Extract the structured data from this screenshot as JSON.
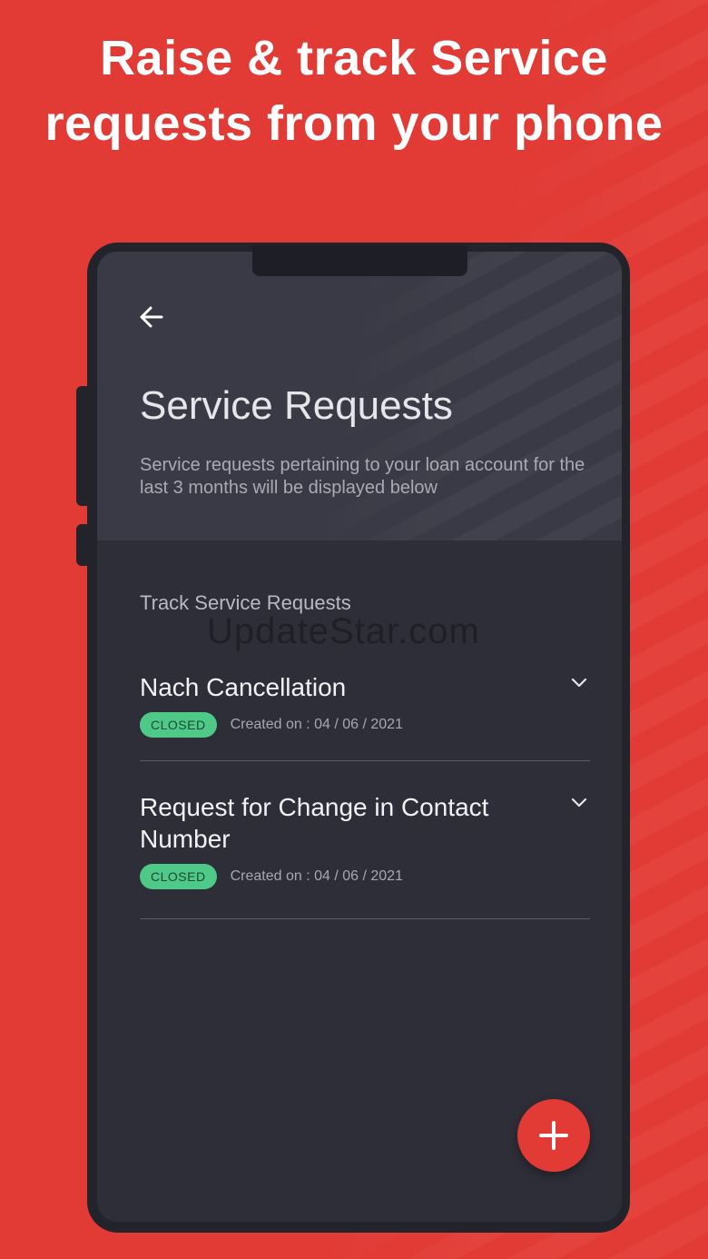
{
  "promo": {
    "headline_line1": "Raise & track Service",
    "headline_line2": "requests from your phone"
  },
  "colors": {
    "background": "#e23a35",
    "screen": "#2d2e38",
    "header": "#393a45",
    "badge_closed": "#4ec988",
    "fab": "#e23a35"
  },
  "header": {
    "back_icon": "arrow-left-icon",
    "title": "Service Requests",
    "subtitle": "Service requests pertaining to your loan account for the last 3 months will be displayed below"
  },
  "section": {
    "label": "Track Service Requests"
  },
  "watermark": "UpdateStar.com",
  "requests": [
    {
      "title": "Nach Cancellation",
      "status": "CLOSED",
      "created": "Created on : 04 / 06 / 2021",
      "icon": "chevron-down-icon"
    },
    {
      "title": "Request for Change in Contact Number",
      "status": "CLOSED",
      "created": "Created on : 04 / 06 / 2021",
      "icon": "chevron-down-icon"
    }
  ],
  "fab": {
    "icon": "plus-icon"
  }
}
